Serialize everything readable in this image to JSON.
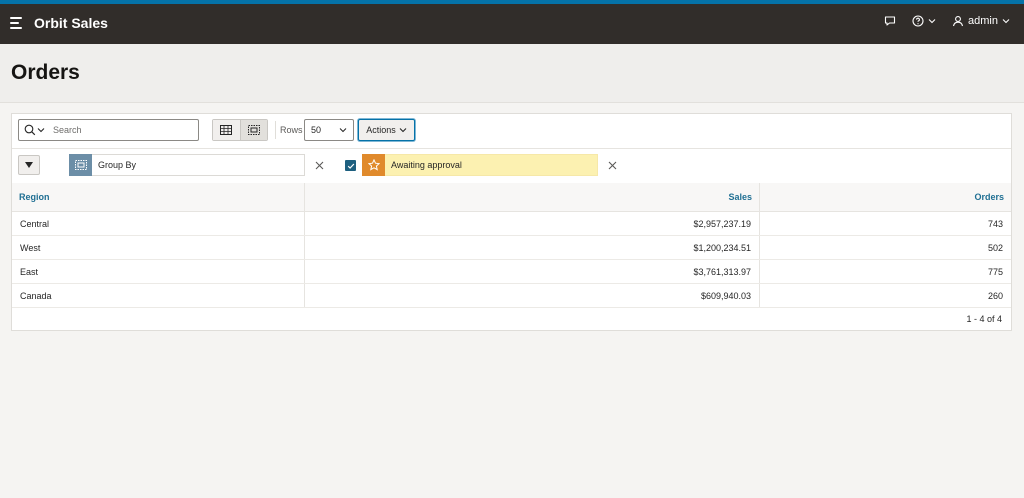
{
  "header": {
    "app_title": "Orbit Sales",
    "user_label": "admin"
  },
  "page": {
    "title": "Orders"
  },
  "toolbar": {
    "search_placeholder": "Search",
    "rows_label": "Rows",
    "rows_value": "50",
    "actions_label": "Actions"
  },
  "filters": {
    "group_by_label": "Group By",
    "approval_label": "Awaiting approval"
  },
  "table": {
    "columns": [
      "Region",
      "Sales",
      "Orders"
    ],
    "rows": [
      {
        "region": "Central",
        "sales": "$2,957,237.19",
        "orders": "743"
      },
      {
        "region": "West",
        "sales": "$1,200,234.51",
        "orders": "502"
      },
      {
        "region": "East",
        "sales": "$3,761,313.97",
        "orders": "775"
      },
      {
        "region": "Canada",
        "sales": "$609,940.03",
        "orders": "260"
      }
    ]
  },
  "pagination": {
    "text": "1 - 4 of 4"
  },
  "colors": {
    "header_bg": "#312d2a",
    "accent": "#0572a8",
    "column_header_text": "#1f6f93",
    "group_by_icon_bg": "#6c8ea7",
    "approval_icon_bg": "#e08a2c",
    "approval_chip_bg": "#fcf1b1"
  },
  "icons": {
    "menu": "hamburger-icon",
    "chat": "chat-bubble-icon",
    "help": "help-icon",
    "user": "user-icon",
    "search": "search-icon",
    "grid_view": "grid-view-icon",
    "group_view": "group-view-icon",
    "filter_star": "star-icon",
    "remove": "close-icon"
  }
}
